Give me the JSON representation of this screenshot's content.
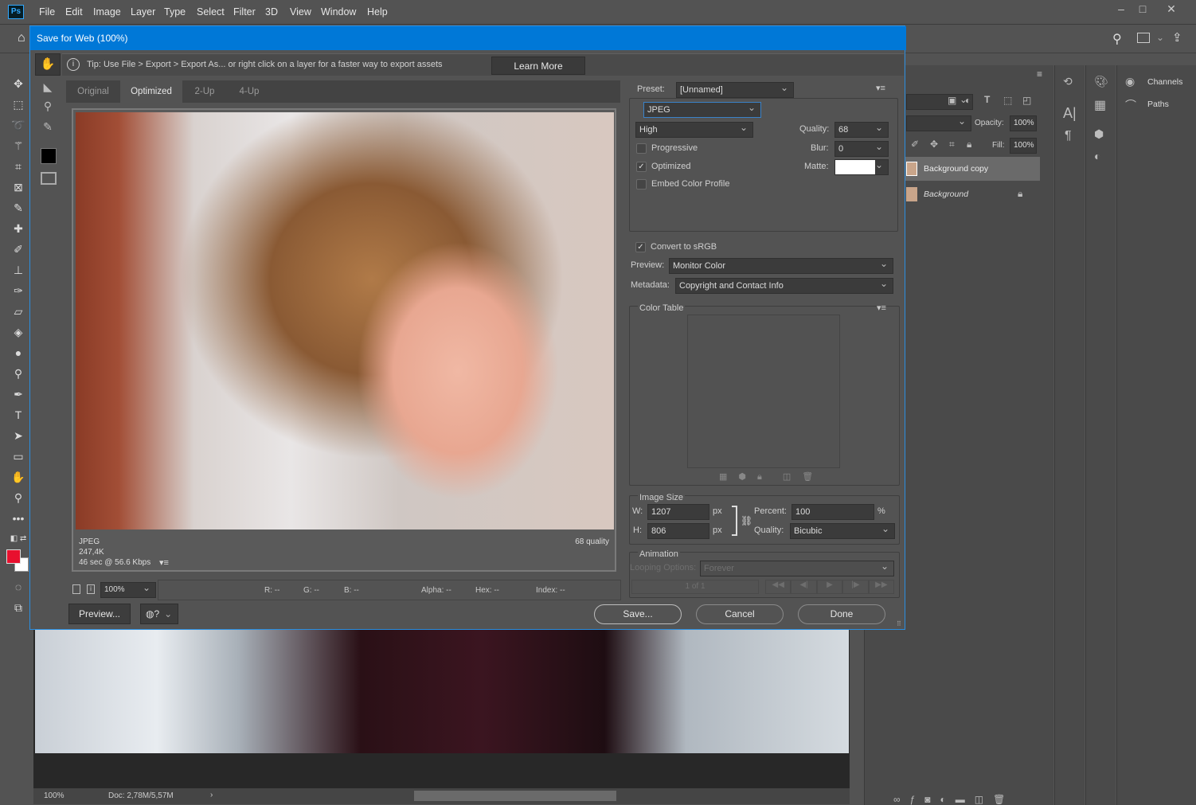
{
  "app": {
    "logo": "Ps",
    "menu": [
      "File",
      "Edit",
      "Image",
      "Layer",
      "Type",
      "Select",
      "Filter",
      "3D",
      "View",
      "Window",
      "Help"
    ],
    "window_controls": {
      "minimize": "–",
      "maximize": "□",
      "close": "✕"
    }
  },
  "statusbar": {
    "zoom": "100%",
    "doc": "Doc: 2,78M/5,57M",
    "arrow": "›"
  },
  "dialog": {
    "title": "Save for Web (100%)",
    "tip": "Tip: Use File > Export > Export As...  or right click on a layer for a faster way to export assets",
    "learn_more": "Learn More",
    "tabs": [
      {
        "label": "Original",
        "active": false
      },
      {
        "label": "Optimized",
        "active": true
      },
      {
        "label": "2-Up",
        "active": false
      },
      {
        "label": "4-Up",
        "active": false
      }
    ],
    "preview_info": {
      "format": "JPEG",
      "size": "247,4K",
      "time": "46 sec @ 56.6 Kbps",
      "quality_label": "68 quality"
    },
    "bottom_bar": {
      "zoom": "100%",
      "r": "R: --",
      "g": "G: --",
      "b": "B: --",
      "alpha": "Alpha: --",
      "hex": "Hex: --",
      "index": "Index: --"
    },
    "buttons": {
      "preview": "Preview...",
      "save": "Save...",
      "cancel": "Cancel",
      "done": "Done"
    },
    "settings": {
      "preset_label": "Preset:",
      "preset_value": "[Unnamed]",
      "format": "JPEG",
      "compression": "High",
      "quality_label": "Quality:",
      "quality_value": "68",
      "blur_label": "Blur:",
      "blur_value": "0",
      "matte_label": "Matte:",
      "matte_color": "#ffffff",
      "progressive": {
        "label": "Progressive",
        "checked": false
      },
      "optimized": {
        "label": "Optimized",
        "checked": true
      },
      "embed_profile": {
        "label": "Embed Color Profile",
        "checked": false
      },
      "convert_srgb": {
        "label": "Convert to sRGB",
        "checked": true
      },
      "preview_label": "Preview:",
      "preview_value": "Monitor Color",
      "metadata_label": "Metadata:",
      "metadata_value": "Copyright and Contact Info"
    },
    "color_table": {
      "title": "Color Table"
    },
    "image_size": {
      "title": "Image Size",
      "w_label": "W:",
      "w_value": "1207",
      "h_label": "H:",
      "h_value": "806",
      "unit": "px",
      "percent_label": "Percent:",
      "percent_value": "100",
      "percent_unit": "%",
      "quality_label": "Quality:",
      "quality_value": "Bicubic"
    },
    "animation": {
      "title": "Animation",
      "looping_label": "Looping Options:",
      "looping_value": "Forever",
      "frame": "1 of 1"
    }
  },
  "layers_panel": {
    "opacity_label": "Opacity:",
    "opacity_value": "100%",
    "fill_label": "Fill:",
    "fill_value": "100%",
    "layers": [
      {
        "name": "Background copy",
        "selected": true,
        "locked": false
      },
      {
        "name": "Background",
        "selected": false,
        "locked": true
      }
    ]
  },
  "side_panels": {
    "channels": "Channels",
    "paths": "Paths"
  },
  "colors": {
    "foreground": "#e8102e",
    "background": "#ffffff",
    "accent": "#0078d7"
  }
}
